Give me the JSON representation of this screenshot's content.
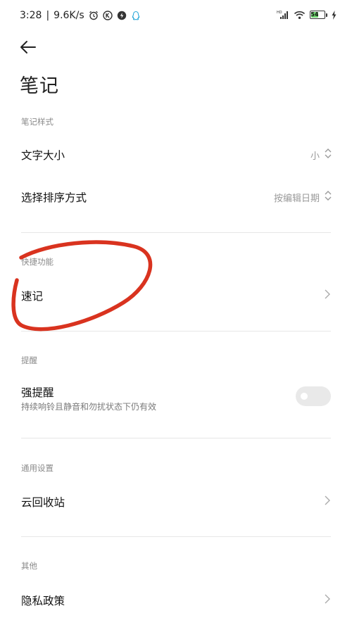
{
  "status_bar": {
    "time": "3:28",
    "network_speed": "9.6K/s",
    "left_icons": [
      "alarm-icon",
      "k-app-icon",
      "shield-bolt-icon",
      "qq-icon"
    ],
    "signal_label": "HD",
    "battery_level": "54",
    "right_icons": [
      "signal-icon",
      "wifi-icon",
      "battery-icon",
      "charging-icon"
    ]
  },
  "header": {
    "title": "笔记"
  },
  "sections": {
    "note_style": {
      "header": "笔记样式",
      "font_size": {
        "label": "文字大小",
        "value": "小"
      },
      "sort": {
        "label": "选择排序方式",
        "value": "按编辑日期"
      }
    },
    "quick_features": {
      "header": "快捷功能",
      "quick_note": {
        "label": "速记"
      }
    },
    "reminder": {
      "header": "提醒",
      "strong_reminder": {
        "label": "强提醒",
        "description": "持续响铃且静音和勿扰状态下仍有效",
        "enabled": false
      }
    },
    "general": {
      "header": "通用设置",
      "cloud_recycle_bin": {
        "label": "云回收站"
      }
    },
    "other": {
      "header": "其他",
      "privacy_policy": {
        "label": "隐私政策"
      }
    }
  },
  "colors": {
    "annotation": "#d9331f",
    "battery_fill": "#6ad06a",
    "toggle_off": "#e9e9e9"
  }
}
